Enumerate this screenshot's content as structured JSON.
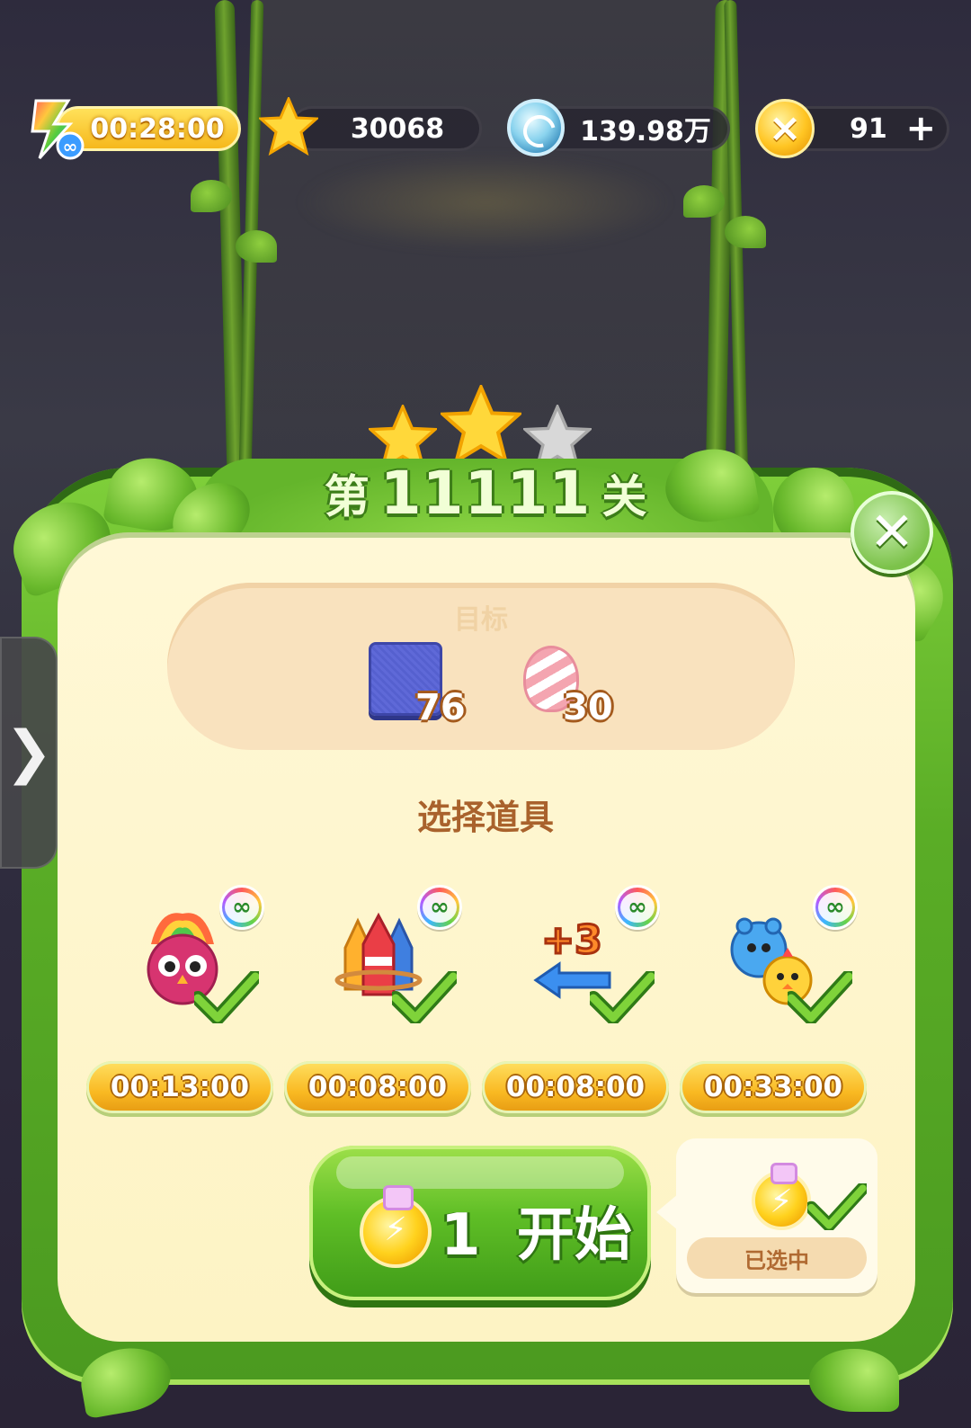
{
  "hud": {
    "energy_timer": "00:28:00",
    "stars": "30068",
    "gems": "139.98万",
    "coins": "91",
    "coins_add": "+"
  },
  "level": {
    "prefix": "第",
    "number": "11111",
    "suffix": "关",
    "stars_earned": 2,
    "stars_total": 3
  },
  "target": {
    "label": "目标",
    "goals": [
      {
        "icon": "blue-tile-icon",
        "count": "76"
      },
      {
        "icon": "marshmallow-candy-icon",
        "count": "30"
      }
    ]
  },
  "boosters": {
    "title": "选择道具",
    "items": [
      {
        "icon": "rainbow-owl-booster-icon",
        "timer": "00:13:00",
        "unlimited": true,
        "selected": true
      },
      {
        "icon": "rocket-booster-icon",
        "timer": "00:08:00",
        "unlimited": true,
        "selected": true
      },
      {
        "icon": "plus-three-moves-booster-icon",
        "timer": "00:08:00",
        "unlimited": true,
        "selected": true
      },
      {
        "icon": "animal-pair-booster-icon",
        "timer": "00:33:00",
        "unlimited": true,
        "selected": true
      }
    ],
    "unlimited_symbol": "∞"
  },
  "start": {
    "cost": "1",
    "label": "开始"
  },
  "potion_card": {
    "status": "已选中"
  },
  "side_tab": {
    "glyph": "❯"
  },
  "close": {
    "glyph": "✕"
  },
  "colors": {
    "panel_green": "#5aad26",
    "panel_cream": "#fff8d6",
    "timer_gold": "#f9b922",
    "title_brown": "#a9622c"
  }
}
